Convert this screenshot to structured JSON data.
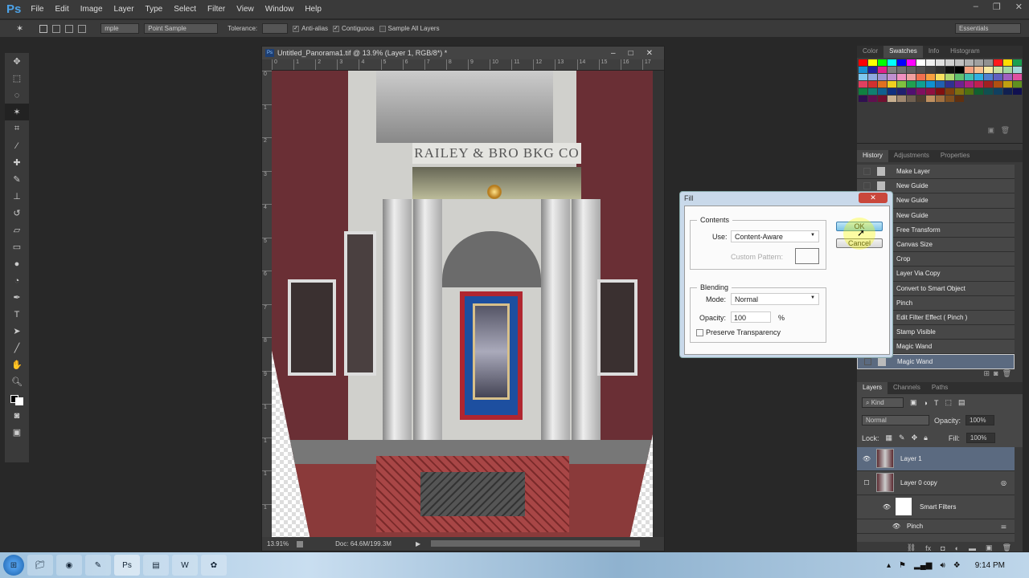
{
  "app": {
    "logo": "Ps",
    "menu": [
      "File",
      "Edit",
      "Image",
      "Layer",
      "Type",
      "Select",
      "Filter",
      "View",
      "Window",
      "Help"
    ],
    "window_controls": [
      "–",
      "❐",
      "✕"
    ]
  },
  "options": {
    "sample_size_partial": "mple",
    "sample": "Point Sample",
    "tolerance_label": "Tolerance:",
    "tolerance_value": "",
    "anti_alias": "Anti-alias",
    "contiguous": "Contiguous",
    "sample_all": "Sample All Layers",
    "workspace": "Essentials"
  },
  "document": {
    "title": "Untitled_Panorama1.tif @ 13.9% (Layer 1, RGB/8*) *",
    "ruler_x": [
      "0",
      "1",
      "2",
      "3",
      "4",
      "5",
      "6",
      "7",
      "8",
      "9",
      "10",
      "11",
      "12",
      "13",
      "14",
      "15",
      "16",
      "17"
    ],
    "ruler_y": [
      "0",
      "1",
      "2",
      "3",
      "4",
      "5",
      "6",
      "7",
      "8",
      "9",
      "1",
      "1",
      "1",
      "1"
    ],
    "sign": "RAILEY & BRO BKG CO",
    "zoom": "13.91%",
    "doc_size": "Doc: 64.6M/199.3M"
  },
  "swatch_panel": {
    "tabs": [
      "Color",
      "Swatches",
      "Info",
      "Histogram"
    ],
    "active": "Swatches",
    "colors": [
      "#ff0000",
      "#ffff00",
      "#00ff00",
      "#00ffff",
      "#0000ff",
      "#ff00ff",
      "#ffffff",
      "#f0f0f0",
      "#e0e0e0",
      "#d0d0d0",
      "#c0c0c0",
      "#b0b0b0",
      "#a0a0a0",
      "#909090",
      "#ff1a1a",
      "#ffdd00",
      "#1aa050",
      "#1a90d0",
      "#2020a0",
      "#e0208a",
      "#808080",
      "#707070",
      "#606060",
      "#505050",
      "#404040",
      "#303030",
      "#101010",
      "#000000",
      "#f4a080",
      "#f8c090",
      "#f8e8a0",
      "#c8e0a0",
      "#a0d8a0",
      "#a0d8d8",
      "#80c8f0",
      "#90a8e0",
      "#a090d0",
      "#c090d0",
      "#f090c0",
      "#f0a0a0",
      "#f07050",
      "#f8a040",
      "#f8e060",
      "#b0d870",
      "#60c070",
      "#40c0b0",
      "#30b0e0",
      "#5080d0",
      "#6060c0",
      "#a060c0",
      "#e050a0",
      "#e04060",
      "#d03030",
      "#e07020",
      "#f0d020",
      "#80c040",
      "#20a050",
      "#10a090",
      "#1090d0",
      "#2060b0",
      "#303090",
      "#702090",
      "#b02080",
      "#c02050",
      "#a02020",
      "#b05010",
      "#c0a010",
      "#609020",
      "#108040",
      "#108070",
      "#106090",
      "#103080",
      "#202070",
      "#501070",
      "#801060",
      "#901040",
      "#801010",
      "#804010",
      "#807010",
      "#507010",
      "#106030",
      "#105050",
      "#104060",
      "#102050",
      "#101050",
      "#301050",
      "#601050",
      "#701030",
      "#c8b090",
      "#a08870",
      "#706050",
      "#504030",
      "#c09060",
      "#a07040",
      "#805020",
      "#603010"
    ]
  },
  "history": {
    "tabs": [
      "History",
      "Adjustments",
      "Properties"
    ],
    "items": [
      "Make Layer",
      "New Guide",
      "New Guide",
      "New Guide",
      "Free Transform",
      "Canvas Size",
      "Crop",
      "Layer Via Copy",
      "Convert to Smart Object",
      "Pinch",
      "Edit Filter Effect ( Pinch )",
      "Stamp Visible",
      "Magic Wand",
      "Magic Wand"
    ]
  },
  "layers": {
    "tabs": [
      "Layers",
      "Channels",
      "Paths"
    ],
    "kind": "Kind",
    "blend": "Normal",
    "opacity_label": "Opacity:",
    "opacity": "100%",
    "lock_label": "Lock:",
    "fill_label": "Fill:",
    "fill": "100%",
    "items": [
      "Layer 1",
      "Layer 0 copy",
      "Smart Filters",
      "Pinch"
    ]
  },
  "fill_dialog": {
    "title": "Fill",
    "contents_label": "Contents",
    "use_label": "Use:",
    "use_value": "Content-Aware",
    "custom_pattern": "Custom Pattern:",
    "blending_label": "Blending",
    "mode_label": "Mode:",
    "mode_value": "Normal",
    "opacity_label": "Opacity:",
    "opacity_value": "100",
    "percent": "%",
    "preserve": "Preserve Transparency",
    "ok": "OK",
    "cancel": "Cancel",
    "close": "✕"
  },
  "taskbar": {
    "clock": "9:14 PM"
  }
}
